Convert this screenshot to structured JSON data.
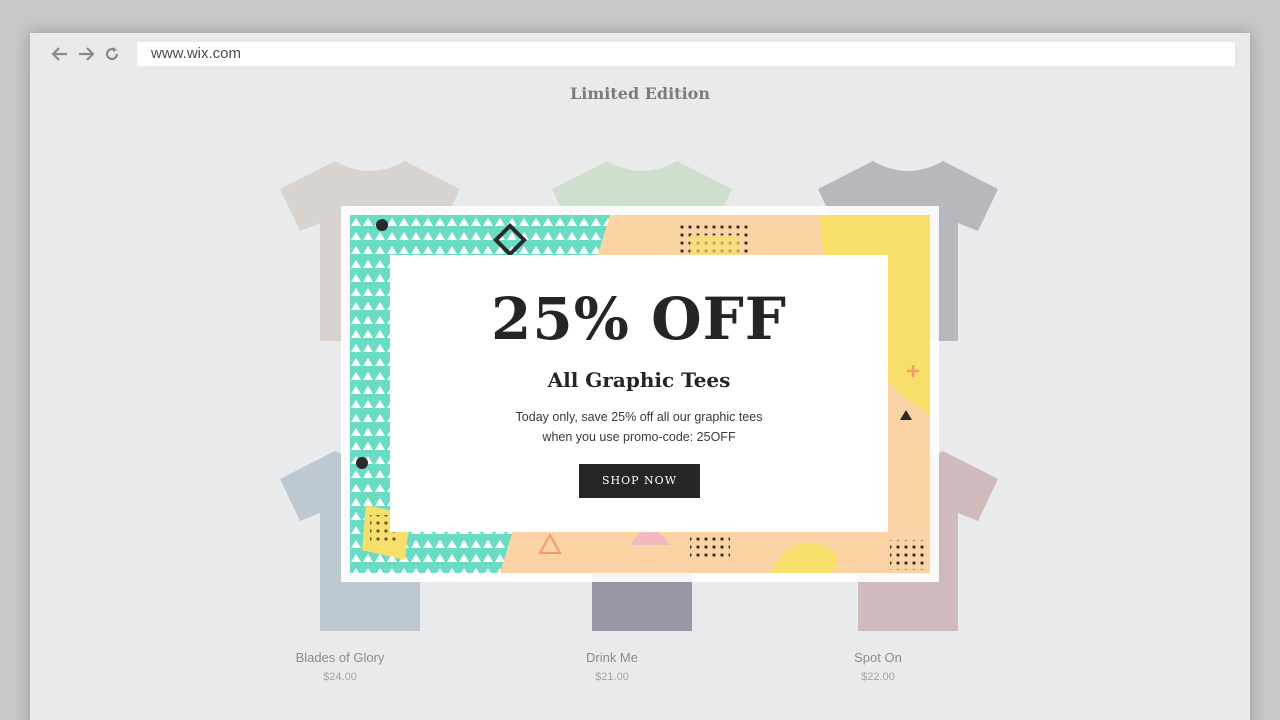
{
  "browser": {
    "url": "www.wix.com"
  },
  "store": {
    "title": "Limited Edition",
    "products": [
      {
        "name": "Blades of Glory",
        "price": "$24.00",
        "color_top": "#c9bdb5",
        "color_bottom": "#9aa9b7"
      },
      {
        "name": "Drink Me",
        "price": "$21.00",
        "color_top": "#b8d3b2",
        "color_bottom": "#5a4f6c"
      },
      {
        "name": "Spot On",
        "price": "$22.00",
        "color_top": "#8b8d94",
        "color_bottom": "#b99290"
      }
    ]
  },
  "popup": {
    "headline": "25% OFF",
    "subhead": "All Graphic Tees",
    "body_line1": "Today only, save 25% off all our graphic tees",
    "body_line2": "when you use promo-code: 25OFF",
    "cta_label": "SHOP NOW"
  },
  "colors": {
    "teal": "#69dcc3",
    "peach": "#fbd3a4",
    "yellow": "#f8df6c",
    "dark": "#262626"
  },
  "icons": [
    "back-arrow-icon",
    "forward-arrow-icon",
    "reload-icon"
  ]
}
